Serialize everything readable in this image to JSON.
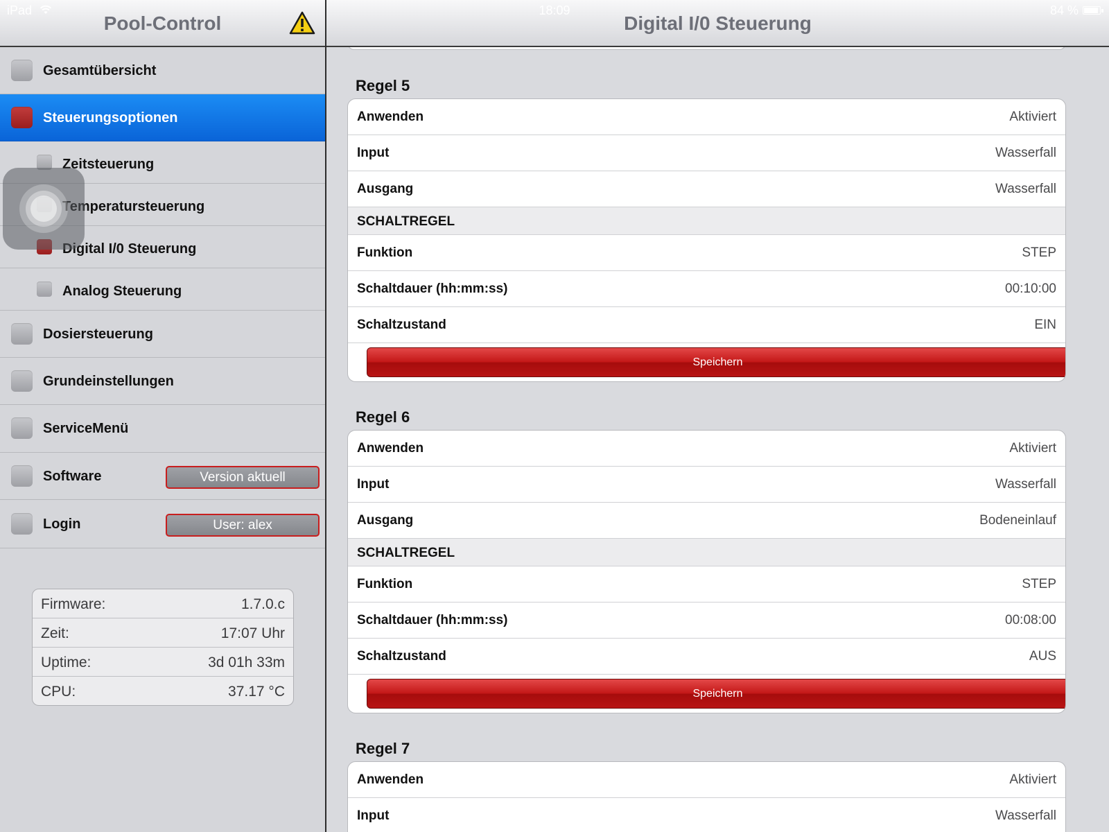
{
  "status_bar": {
    "carrier": "iPad",
    "time": "18:09",
    "battery": "84 %"
  },
  "left": {
    "title": "Pool-Control",
    "menu": [
      {
        "label": "Gesamtübersicht"
      },
      {
        "label": "Steuerungsoptionen"
      },
      {
        "label": "Zeitsteuerung"
      },
      {
        "label": "Temperatursteuerung"
      },
      {
        "label": "Digital I/0 Steuerung"
      },
      {
        "label": "Analog Steuerung"
      },
      {
        "label": "Dosiersteuerung"
      },
      {
        "label": "Grundeinstellungen"
      },
      {
        "label": "ServiceMenü"
      },
      {
        "label": "Software",
        "badge": "Version aktuell"
      },
      {
        "label": "Login",
        "badge": "User: alex"
      }
    ],
    "info": [
      {
        "key": "Firmware:",
        "value": "1.7.0.c"
      },
      {
        "key": "Zeit:",
        "value": "17:07 Uhr"
      },
      {
        "key": "Uptime:",
        "value": "3d 01h 33m"
      },
      {
        "key": "CPU:",
        "value": "37.17 °C"
      }
    ]
  },
  "right": {
    "title": "Digital I/0 Steuerung",
    "rules": [
      {
        "title": "Regel 5",
        "rows": [
          {
            "key": "Anwenden",
            "value": "Aktiviert"
          },
          {
            "key": "Input",
            "value": "Wasserfall"
          },
          {
            "key": "Ausgang",
            "value": "Wasserfall"
          },
          {
            "key": "SCHALTREGEL",
            "value": ""
          },
          {
            "key": "Funktion",
            "value": "STEP"
          },
          {
            "key": "Schaltdauer (hh:mm:ss)",
            "value": "00:10:00"
          },
          {
            "key": "Schaltzustand",
            "value": "EIN"
          }
        ],
        "save_label": "Speichern"
      },
      {
        "title": "Regel 6",
        "rows": [
          {
            "key": "Anwenden",
            "value": "Aktiviert"
          },
          {
            "key": "Input",
            "value": "Wasserfall"
          },
          {
            "key": "Ausgang",
            "value": "Bodeneinlauf"
          },
          {
            "key": "SCHALTREGEL",
            "value": ""
          },
          {
            "key": "Funktion",
            "value": "STEP"
          },
          {
            "key": "Schaltdauer (hh:mm:ss)",
            "value": "00:08:00"
          },
          {
            "key": "Schaltzustand",
            "value": "AUS"
          }
        ],
        "save_label": "Speichern"
      },
      {
        "title": "Regel 7",
        "rows": [
          {
            "key": "Anwenden",
            "value": "Aktiviert"
          },
          {
            "key": "Input",
            "value": "Wasserfall"
          }
        ]
      }
    ]
  }
}
